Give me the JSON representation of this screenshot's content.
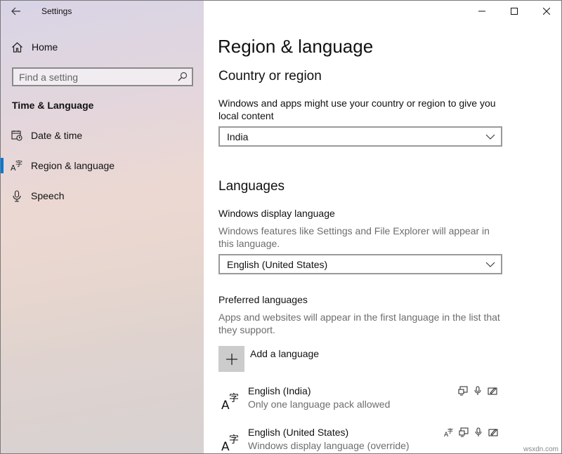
{
  "app": {
    "title": "Settings"
  },
  "sidebar": {
    "home_label": "Home",
    "search_placeholder": "Find a setting",
    "section_heading": "Time & Language",
    "items": [
      {
        "label": "Date & time",
        "icon": "calendar-clock-icon"
      },
      {
        "label": "Region & language",
        "icon": "language-icon",
        "active": true
      },
      {
        "label": "Speech",
        "icon": "microphone-icon"
      }
    ]
  },
  "main": {
    "title": "Region & language",
    "country": {
      "heading": "Country or region",
      "description": "Windows and apps might use your country or region to give you local content",
      "selected": "India"
    },
    "languages": {
      "heading": "Languages",
      "display_label": "Windows display language",
      "display_description": "Windows features like Settings and File Explorer will appear in this language.",
      "display_selected": "English (United States)",
      "preferred_label": "Preferred languages",
      "preferred_description": "Apps and websites will appear in the first language in the list that they support.",
      "add_label": "Add a language",
      "list": [
        {
          "name": "English (India)",
          "sub": "Only one language pack allowed",
          "features": [
            "display-language-icon",
            "speech-icon",
            "handwriting-icon"
          ]
        },
        {
          "name": "English (United States)",
          "sub": "Windows display language (override)",
          "features": [
            "language-pack-icon",
            "display-language-icon",
            "speech-icon",
            "handwriting-icon"
          ]
        }
      ]
    }
  },
  "watermark": "wsxdn.com",
  "colors": {
    "accent": "#0078d7",
    "tile": "#cccccc"
  }
}
